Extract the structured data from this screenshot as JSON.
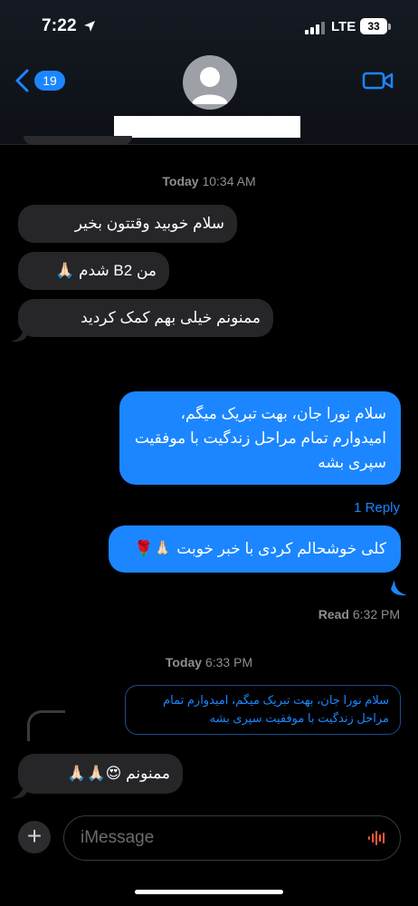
{
  "status": {
    "time": "7:22",
    "network": "LTE",
    "battery": "33"
  },
  "header": {
    "back_count": "19"
  },
  "timestamps": {
    "first_day": "Today",
    "first_time": "10:34 AM",
    "second_day": "Today",
    "second_time": "6:33 PM"
  },
  "messages": [
    {
      "direction": "incoming",
      "text": "سلام خوبید وقتتون بخیر"
    },
    {
      "direction": "incoming",
      "text": "من B2 شدم 🙏🏻"
    },
    {
      "direction": "incoming",
      "text": "ممنونم خیلی بهم کمک کردید"
    },
    {
      "direction": "outgoing",
      "text": "سلام نورا جان، بهت تبریک میگم، امیدوارم تمام مراحل زندگیت با موفقیت سپری بشه"
    },
    {
      "direction": "outgoing",
      "text": "کلی خوشحالم کردی با خبر خوبت 🙏🏻🌹"
    },
    {
      "direction": "incoming",
      "text": "ممنونم 😍🙏🏻🙏🏻"
    }
  ],
  "reply_link": "1 Reply",
  "read_receipt": {
    "label": "Read",
    "time": "6:32 PM"
  },
  "quoted_reply": "سلام نورا جان، بهت تبریک میگم، امیدوارم تمام مراحل زندگیت با موفقیت سپری بشه",
  "composer": {
    "placeholder": "iMessage"
  },
  "icons": [
    "location-arrow-icon",
    "signal-icon",
    "battery-icon",
    "chevron-left-icon",
    "person-icon",
    "video-camera-icon",
    "plus-icon",
    "waveform-icon"
  ],
  "colors": {
    "accent": "#1b86ff",
    "incoming_bubble": "#262628",
    "outgoing_bubble": "#1b86ff",
    "background": "#000000",
    "muted_text": "#8e8e93"
  }
}
